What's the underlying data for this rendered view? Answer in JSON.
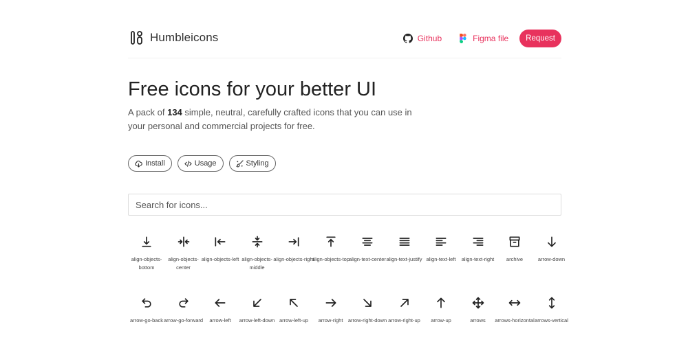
{
  "header": {
    "brand": "Humbleicons",
    "github_label": "Github",
    "figma_label": "Figma file",
    "request_label": "Request",
    "accent_color": "#e8325d"
  },
  "hero": {
    "title": "Free icons for your better UI",
    "desc_prefix": "A pack of ",
    "count": "134",
    "desc_suffix": " simple, neutral, carefully crafted icons that you can use in your personal and commercial projects for free."
  },
  "pills": [
    {
      "label": "Install",
      "icon": "cloud-download-icon"
    },
    {
      "label": "Usage",
      "icon": "code-icon"
    },
    {
      "label": "Styling",
      "icon": "brush-icon"
    }
  ],
  "search": {
    "placeholder": "Search for icons..."
  },
  "icons": [
    {
      "label": "align-objects-bottom"
    },
    {
      "label": "align-objects-center"
    },
    {
      "label": "align-objects-left"
    },
    {
      "label": "align-objects-middle"
    },
    {
      "label": "align-objects-right"
    },
    {
      "label": "align-objects-top"
    },
    {
      "label": "align-text-center"
    },
    {
      "label": "align-text-justify"
    },
    {
      "label": "align-text-left"
    },
    {
      "label": "align-text-right"
    },
    {
      "label": "archive"
    },
    {
      "label": "arrow-down"
    },
    {
      "label": "arrow-go-back"
    },
    {
      "label": "arrow-go-forward"
    },
    {
      "label": "arrow-left"
    },
    {
      "label": "arrow-left-down"
    },
    {
      "label": "arrow-left-up"
    },
    {
      "label": "arrow-right"
    },
    {
      "label": "arrow-right-down"
    },
    {
      "label": "arrow-right-up"
    },
    {
      "label": "arrow-up"
    },
    {
      "label": "arrows"
    },
    {
      "label": "arrows-horizontal"
    },
    {
      "label": "arrows-vertical"
    }
  ]
}
